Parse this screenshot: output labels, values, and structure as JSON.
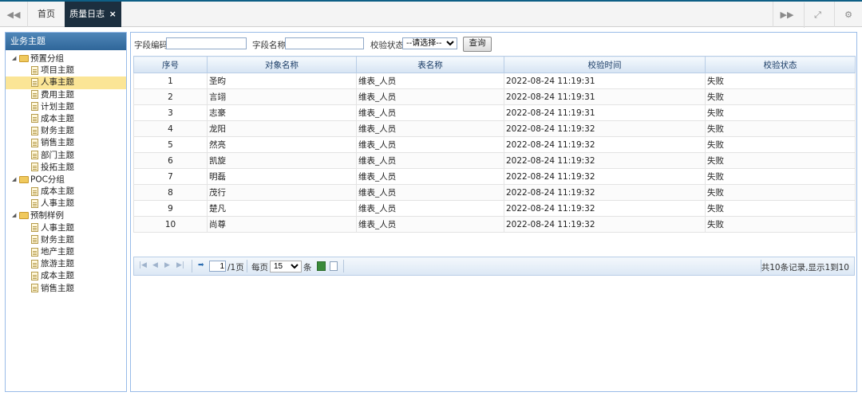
{
  "tabs": {
    "home": "首页",
    "active": "质量日志",
    "close_glyph": "×"
  },
  "sidebar": {
    "title": "业务主题",
    "groups": [
      {
        "label": "预置分组",
        "items": [
          "项目主题",
          "人事主题",
          "费用主题",
          "计划主题",
          "成本主题",
          "财务主题",
          "销售主题",
          "部门主题",
          "投拓主题"
        ]
      },
      {
        "label": "POC分组",
        "items": [
          "成本主题",
          "人事主题"
        ]
      },
      {
        "label": "预制样例",
        "items": [
          "人事主题",
          "财务主题",
          "地产主题",
          "旅游主题",
          "成本主题",
          "销售主题"
        ]
      }
    ],
    "selected": "人事主题"
  },
  "search": {
    "field_code_label": "字段编码",
    "field_code_value": "",
    "field_name_label": "字段名称",
    "field_name_value": "",
    "status_label": "校验状态",
    "status_selected": "--请选择--",
    "query_button": "查询"
  },
  "table": {
    "columns": [
      "序号",
      "对象名称",
      "表名称",
      "校验时间",
      "校验状态"
    ],
    "rows": [
      [
        "1",
        "圣昀",
        "维表_人员",
        "2022-08-24 11:19:31",
        "失败"
      ],
      [
        "2",
        "言翊",
        "维表_人员",
        "2022-08-24 11:19:31",
        "失败"
      ],
      [
        "3",
        "志豪",
        "维表_人员",
        "2022-08-24 11:19:31",
        "失败"
      ],
      [
        "4",
        "龙阳",
        "维表_人员",
        "2022-08-24 11:19:32",
        "失败"
      ],
      [
        "5",
        "然亮",
        "维表_人员",
        "2022-08-24 11:19:32",
        "失败"
      ],
      [
        "6",
        "凯旋",
        "维表_人员",
        "2022-08-24 11:19:32",
        "失败"
      ],
      [
        "7",
        "明磊",
        "维表_人员",
        "2022-08-24 11:19:32",
        "失败"
      ],
      [
        "8",
        "茂行",
        "维表_人员",
        "2022-08-24 11:19:32",
        "失败"
      ],
      [
        "9",
        "楚凡",
        "维表_人员",
        "2022-08-24 11:19:32",
        "失败"
      ],
      [
        "10",
        "尚尊",
        "维表_人员",
        "2022-08-24 11:19:32",
        "失败"
      ]
    ]
  },
  "pager": {
    "current_page": "1",
    "total_pages_text": "/1页",
    "per_page_label": "每页",
    "per_page_value": "15",
    "per_page_unit": "条",
    "info": "共10条记录,显示1到10"
  },
  "icons": [
    "first-page-icon",
    "prev-page-icon",
    "next-page-icon",
    "last-page-icon",
    "refresh-icon",
    "excel-export-icon",
    "document-icon",
    "scroll-left-icon",
    "scroll-right-icon",
    "fullscreen-icon",
    "settings-icon"
  ],
  "colors": {
    "top_border": "#0e5f86",
    "active_tab": "#1c2f3f",
    "panel_header": "#2f6699",
    "selected_row": "#fbe596"
  }
}
